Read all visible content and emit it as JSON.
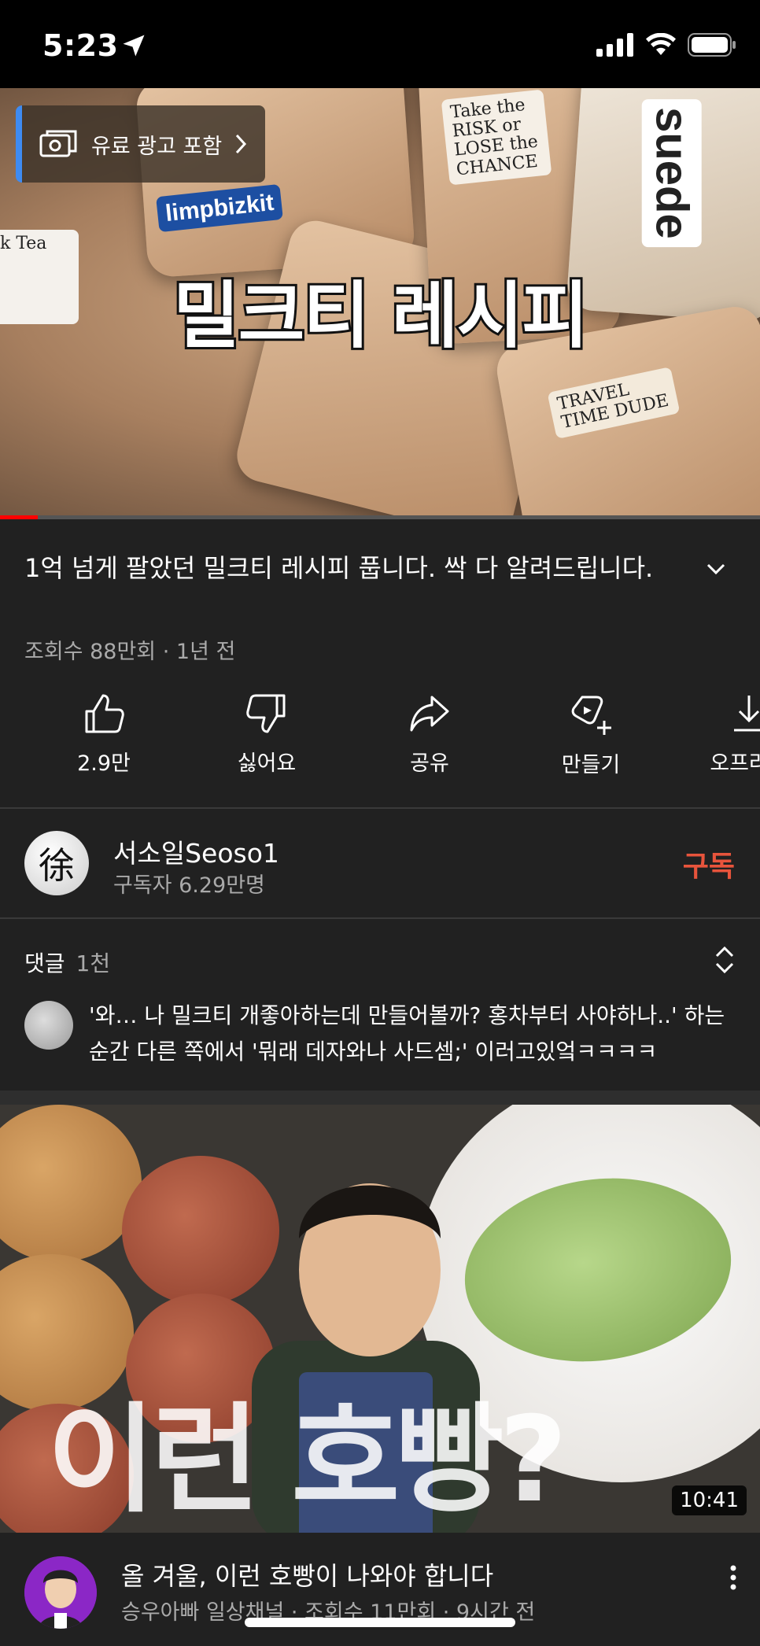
{
  "status_bar": {
    "time": "5:23"
  },
  "player": {
    "overlay_title": "밀크티 레시피",
    "ad_label": "유료 광고 포함",
    "progress_fraction": 0.05,
    "stickers": [
      "Take the RISK or LOSE the CHANCE",
      "limpbizkit",
      "suede",
      "TRAVEL TIME DUDE",
      "k Tea"
    ]
  },
  "video": {
    "title": "1억 넘게 팔았던 밀크티 레시피 풉니다. 싹 다 알려드립니다.",
    "meta": "조회수 88만회 · 1년 전"
  },
  "actions": [
    {
      "icon": "thumbs-up-icon",
      "label": "2.9만"
    },
    {
      "icon": "thumbs-down-icon",
      "label": "싫어요"
    },
    {
      "icon": "share-icon",
      "label": "공유"
    },
    {
      "icon": "remix-icon",
      "label": "만들기"
    },
    {
      "icon": "download-icon",
      "label": "오프라인"
    }
  ],
  "channel": {
    "avatar_char": "徐",
    "name": "서소일Seoso1",
    "subscribers": "구독자 6.29만명",
    "subscribe_label": "구독"
  },
  "comments": {
    "header": "댓글",
    "count": "1천",
    "top_comment": "'와… 나 밀크티 개좋아하는데 만들어볼까? 홍차부터 사야하나..' 하는 순간 다른 쪽에서 '뭐래 데자와나 사드셈;' 이러고있엌ㅋㅋㅋㅋ"
  },
  "next_video": {
    "thumbnail_text": "이런 호빵?",
    "duration": "10:41",
    "title": "올 겨울, 이런 호빵이 나와야 합니다",
    "meta": "승우아빠 일상채널 · 조회수 11만회 · 9시간 전"
  },
  "colors": {
    "background": "#212121",
    "subscribe": "#e8543c",
    "progress": "#ff0000",
    "ad_accent": "#3e8bf2"
  }
}
